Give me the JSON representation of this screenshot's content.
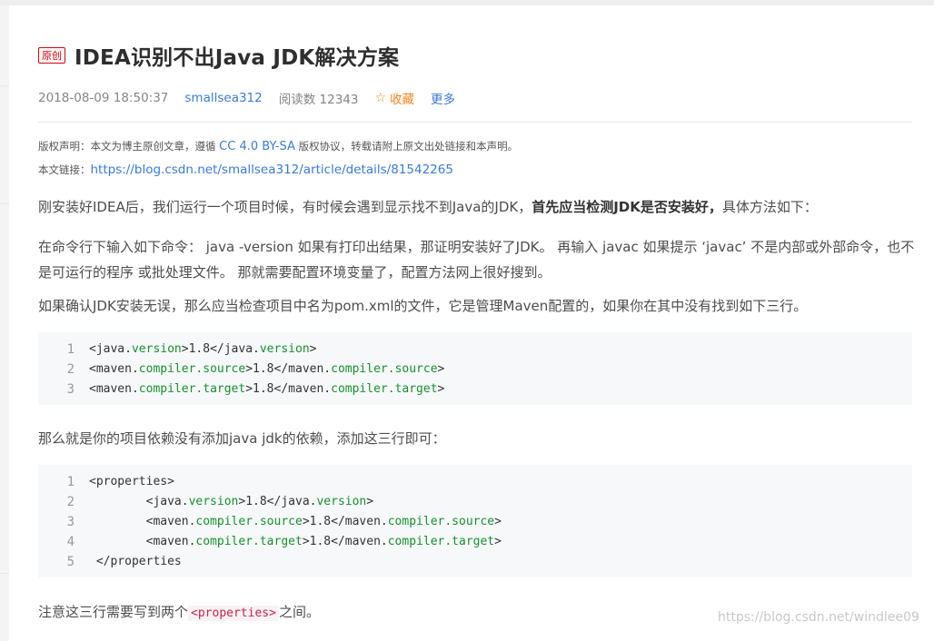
{
  "article": {
    "tag": "原创",
    "title": "IDEA识别不出Java JDK解决方案",
    "meta": {
      "date": "2018-08-09 18:50:37",
      "author": "smallsea312",
      "reads": "阅读数 12343",
      "favorite": "收藏",
      "more": "更多"
    },
    "copyright": {
      "prefix": "版权声明：本文为博主原创文章，遵循 ",
      "license": "CC 4.0 BY-SA",
      "suffix": " 版权协议，转载请附上原文出处链接和本声明。"
    },
    "link": {
      "label": "本文链接：",
      "url": "https://blog.csdn.net/smallsea312/article/details/81542265"
    },
    "p1": {
      "a": "刚安装好IDEA后，我们运行一个项目时候，有时候会遇到显示找不到Java的JDK，",
      "bold": "首先应当检测JDK是否安装好，",
      "c": "具体方法如下："
    },
    "p2": "在命令行下输入如下命令： java -version 如果有打印出结果，那证明安装好了JDK。 再输入 javac 如果提示 ‘javac’ 不是内部或外部命令，也不是可运行的程序 或批处理文件。 那就需要配置环境变量了，配置方法网上很好搜到。",
    "p3": "如果确认JDK安装无误，那么应当检查项目中名为pom.xml的文件，它是管理Maven配置的，如果你在其中没有找到如下三行。",
    "p4": "那么就是你的项目依赖没有添加java jdk的依赖，添加这三行即可：",
    "p5": {
      "a": "注意这三行需要写到两个",
      "code": "<properties>",
      "c": "之间。"
    }
  },
  "code1": {
    "line_numbers": [
      "1",
      "2",
      "3"
    ],
    "lines": [
      [
        {
          "t": "<java.",
          "a": false
        },
        {
          "t": "version",
          "a": true
        },
        {
          "t": ">1.8</java.",
          "a": false
        },
        {
          "t": "version",
          "a": true
        },
        {
          "t": ">",
          "a": false
        }
      ],
      [
        {
          "t": "<maven.",
          "a": false
        },
        {
          "t": "compiler.source",
          "a": true
        },
        {
          "t": ">1.8</maven.",
          "a": false
        },
        {
          "t": "compiler.source",
          "a": true
        },
        {
          "t": ">",
          "a": false
        }
      ],
      [
        {
          "t": "<maven.",
          "a": false
        },
        {
          "t": "compiler.target",
          "a": true
        },
        {
          "t": ">1.8</maven.",
          "a": false
        },
        {
          "t": "compiler.target",
          "a": true
        },
        {
          "t": ">",
          "a": false
        }
      ]
    ]
  },
  "code2": {
    "line_numbers": [
      "1",
      "2",
      "3",
      "4",
      "5"
    ],
    "lines": [
      [
        {
          "t": "<properties>",
          "a": false
        }
      ],
      [
        {
          "t": "        <java.",
          "a": false
        },
        {
          "t": "version",
          "a": true
        },
        {
          "t": ">1.8</java.",
          "a": false
        },
        {
          "t": "version",
          "a": true
        },
        {
          "t": ">",
          "a": false
        }
      ],
      [
        {
          "t": "        <maven.",
          "a": false
        },
        {
          "t": "compiler.source",
          "a": true
        },
        {
          "t": ">1.8</maven.",
          "a": false
        },
        {
          "t": "compiler.source",
          "a": true
        },
        {
          "t": ">",
          "a": false
        }
      ],
      [
        {
          "t": "        <maven.",
          "a": false
        },
        {
          "t": "compiler.target",
          "a": true
        },
        {
          "t": ">1.8</maven.",
          "a": false
        },
        {
          "t": "compiler.target",
          "a": true
        },
        {
          "t": ">",
          "a": false
        }
      ],
      [
        {
          "t": " </properties",
          "a": false
        }
      ]
    ]
  },
  "watermark": "https://blog.csdn.net/windlee09",
  "icons": {
    "favorite": "star-outline-icon"
  },
  "colors": {
    "link": "#3a7bd5",
    "favorite": "#f0861d",
    "tag": "#ca0c16",
    "code_attr": "#1a8f2e"
  }
}
